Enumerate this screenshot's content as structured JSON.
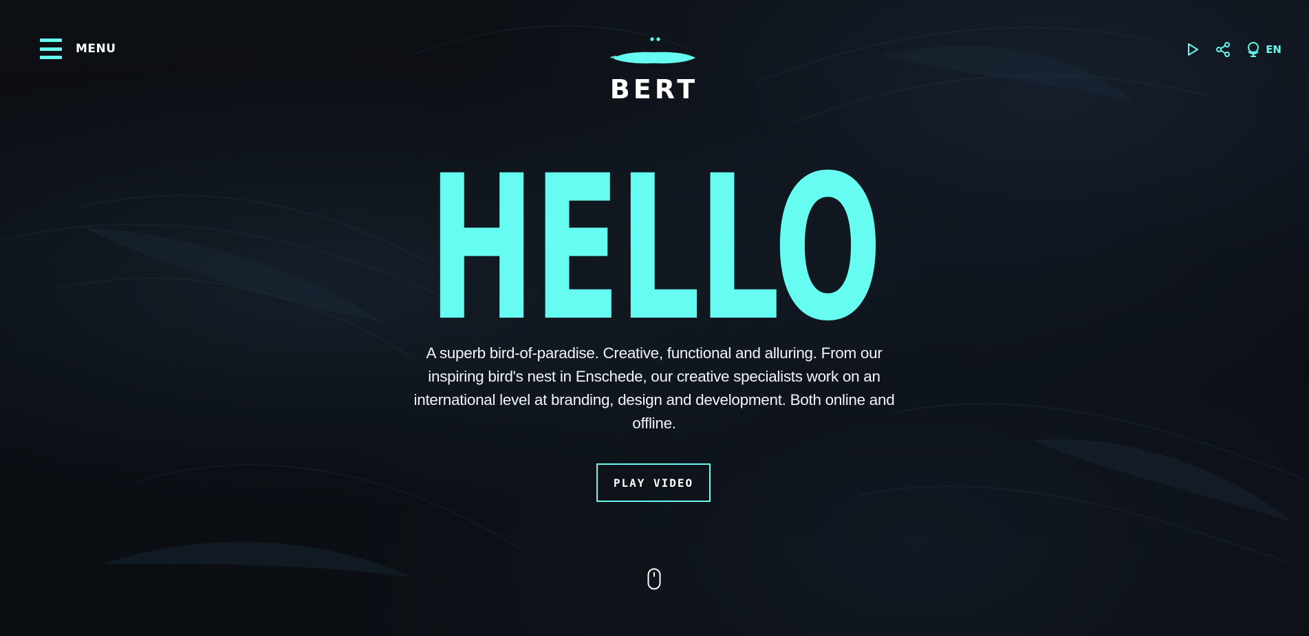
{
  "header": {
    "menu_label": "MENU",
    "logo_text": "BERT",
    "language_code": "EN",
    "icons": [
      "menu-icon",
      "play-icon",
      "share-icon",
      "globe-icon",
      "mouse-scroll-icon"
    ]
  },
  "hero": {
    "title": "HELLO",
    "description": "A superb bird-of-paradise. Creative, functional and alluring. From our inspiring bird's nest in Enschede, our creative specialists work on an international level at branding, design and development. Both online and offline.",
    "button_label": "PLAY VIDEO"
  },
  "colors": {
    "accent": "#66fcf1",
    "background": "#0a0c10",
    "text": "#ffffff"
  }
}
